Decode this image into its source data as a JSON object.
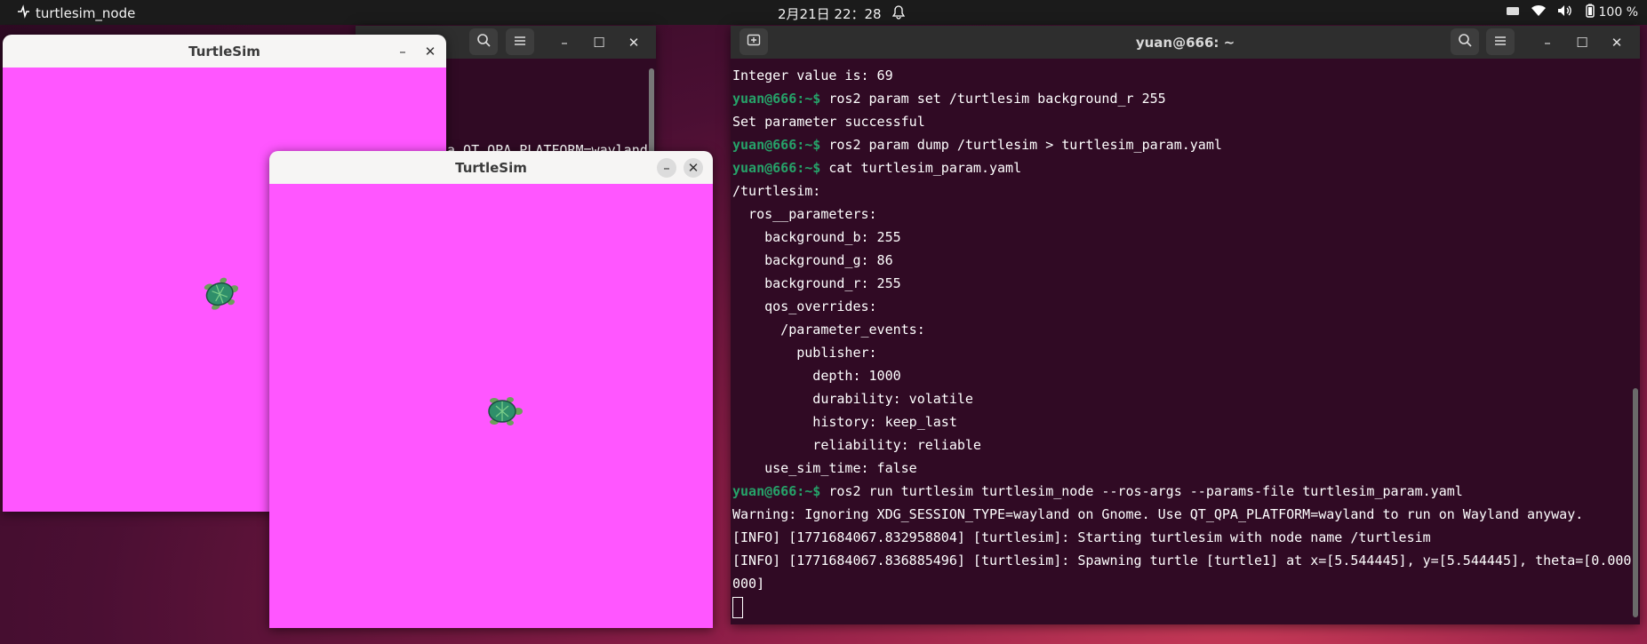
{
  "topbar": {
    "app_name": "turtlesim_node",
    "datetime": "2月21日 22：28",
    "battery": "100 %"
  },
  "windows": {
    "turtlesim_back": {
      "title": "TurtleSim",
      "background_color": "#ff56ff"
    },
    "turtlesim_front": {
      "title": "TurtleSim",
      "background_color": "#ff56ff"
    },
    "terminal_back": {
      "partial_text": "a QT_QPA_PLATFORM=wayland"
    },
    "terminal_main": {
      "title": "yuan@666: ~",
      "prompt": "yuan@666:~$",
      "lines": {
        "l01": "Integer value is: 69",
        "l02": " ros2 param set /turtlesim background_r 255",
        "l03": "Set parameter successful",
        "l04": " ros2 param dump /turtlesim > turtlesim_param.yaml",
        "l05": " cat turtlesim_param.yaml",
        "l06": "/turtlesim:",
        "l07": "  ros__parameters:",
        "l08": "    background_b: 255",
        "l09": "    background_g: 86",
        "l10": "    background_r: 255",
        "l11": "    qos_overrides:",
        "l12": "      /parameter_events:",
        "l13": "        publisher:",
        "l14": "          depth: 1000",
        "l15": "          durability: volatile",
        "l16": "          history: keep_last",
        "l17": "          reliability: reliable",
        "l18": "    use_sim_time: false",
        "l19": " ros2 run turtlesim turtlesim_node --ros-args --params-file turtlesim_param.yaml",
        "l20": "Warning: Ignoring XDG_SESSION_TYPE=wayland on Gnome. Use QT_QPA_PLATFORM=wayland to run on Wayland anyway.",
        "l21": "[INFO] [1771684067.832958804] [turtlesim]: Starting turtlesim with node name /turtlesim",
        "l22": "[INFO] [1771684067.836885496] [turtlesim]: Spawning turtle [turtle1] at x=[5.544445], y=[5.544445], theta=[0.000",
        "l23": "000]"
      }
    }
  },
  "colors": {
    "terminal_bg": "#300a24",
    "prompt_green": "#26a269",
    "turtlesim_bg": "#ff56ff"
  },
  "icons": [
    "activities-icon",
    "notification-bell-icon",
    "keyboard-icon",
    "wifi-icon",
    "volume-icon",
    "battery-icon",
    "new-tab-icon",
    "search-icon",
    "hamburger-menu-icon",
    "minimize-icon",
    "maximize-icon",
    "close-icon",
    "turtle-icon"
  ]
}
